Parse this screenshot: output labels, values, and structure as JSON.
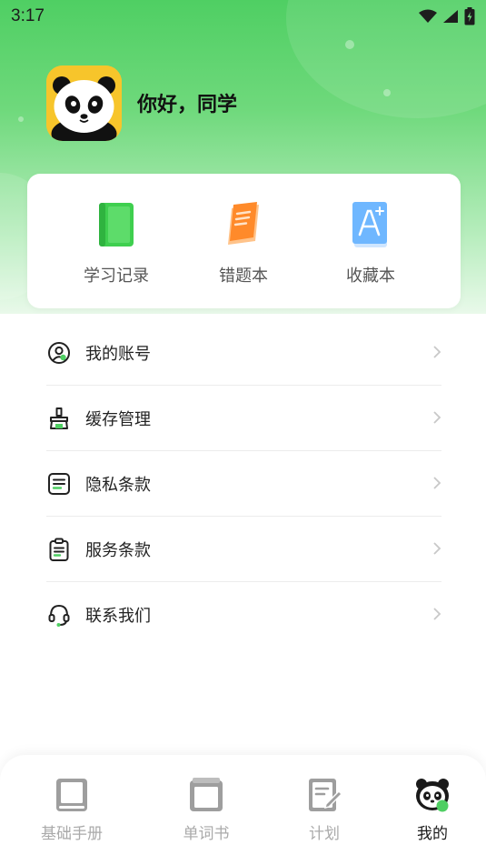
{
  "status_bar": {
    "time": "3:17"
  },
  "profile": {
    "greeting": "你好，同学"
  },
  "quick_actions": [
    {
      "label": "学习记录",
      "icon": "green-book-icon"
    },
    {
      "label": "错题本",
      "icon": "orange-notebook-icon"
    },
    {
      "label": "收藏本",
      "icon": "blue-letter-a-icon"
    }
  ],
  "menu": [
    {
      "label": "我的账号",
      "icon": "user-circle-icon"
    },
    {
      "label": "缓存管理",
      "icon": "broom-icon"
    },
    {
      "label": "隐私条款",
      "icon": "document-icon"
    },
    {
      "label": "服务条款",
      "icon": "clipboard-icon"
    },
    {
      "label": "联系我们",
      "icon": "headset-icon"
    }
  ],
  "bottom_nav": [
    {
      "label": "基础手册",
      "icon": "manual-icon",
      "active": false
    },
    {
      "label": "单词书",
      "icon": "wordbook-icon",
      "active": false
    },
    {
      "label": "计划",
      "icon": "plan-icon",
      "active": false
    },
    {
      "label": "我的",
      "icon": "panda-icon",
      "active": true
    }
  ],
  "colors": {
    "accent": "#4fcf63",
    "active_nav": "#1a1a1a",
    "inactive_nav": "#aaaaaa"
  }
}
